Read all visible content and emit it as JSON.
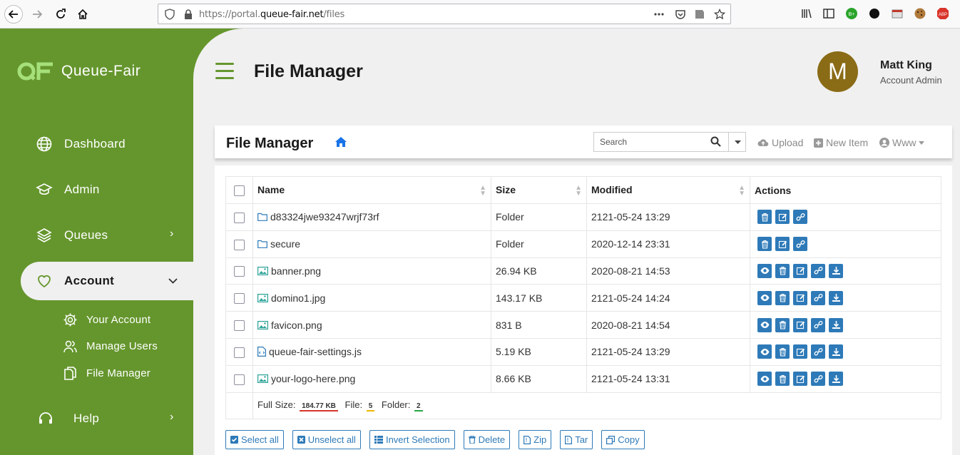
{
  "browser": {
    "url_prefix": "https://portal.",
    "url_domain": "queue-fair.net",
    "url_path": "/files"
  },
  "sidebar": {
    "logo_text": "Queue-Fair",
    "items": [
      {
        "label": "Dashboard",
        "icon": "globe-icon"
      },
      {
        "label": "Admin",
        "icon": "graduation-cap-icon"
      },
      {
        "label": "Queues",
        "icon": "layers-icon",
        "chevron": "›"
      },
      {
        "label": "Account",
        "icon": "heart-icon",
        "chevron": "⌄"
      },
      {
        "label": "Help",
        "icon": "headset-icon",
        "chevron": "›"
      }
    ],
    "sub_items": [
      {
        "label": "Your Account",
        "icon": "gear-icon"
      },
      {
        "label": "Manage Users",
        "icon": "users-icon"
      },
      {
        "label": "File Manager",
        "icon": "files-icon"
      }
    ]
  },
  "header": {
    "title": "File Manager",
    "avatar_letter": "M",
    "user_name": "Matt King",
    "user_role": "Account Admin"
  },
  "card": {
    "title": "File Manager",
    "search_placeholder": "Search",
    "upload_label": "Upload",
    "new_item_label": "New Item",
    "user_menu_label": "Www"
  },
  "table": {
    "headers": {
      "name": "Name",
      "size": "Size",
      "modified": "Modified",
      "actions": "Actions"
    },
    "rows": [
      {
        "name": "d83324jwe93247wrjf73rf",
        "type": "folder",
        "size": "Folder",
        "modified": "2121-05-24 13:29"
      },
      {
        "name": "secure",
        "type": "folder",
        "size": "Folder",
        "modified": "2020-12-14 23:31"
      },
      {
        "name": "banner.png",
        "type": "image",
        "size": "26.94 KB",
        "modified": "2020-08-21 14:53"
      },
      {
        "name": "domino1.jpg",
        "type": "image",
        "size": "143.17 KB",
        "modified": "2121-05-24 14:24"
      },
      {
        "name": "favicon.png",
        "type": "image",
        "size": "831 B",
        "modified": "2020-08-21 14:54"
      },
      {
        "name": "queue-fair-settings.js",
        "type": "code",
        "size": "5.19 KB",
        "modified": "2121-05-24 13:29"
      },
      {
        "name": "your-logo-here.png",
        "type": "image",
        "size": "8.66 KB",
        "modified": "2121-05-24 13:31"
      }
    ],
    "footer": {
      "full_size_label": "Full Size:",
      "full_size_value": "184.77 KB",
      "file_label": "File:",
      "file_count": "5",
      "folder_label": "Folder:",
      "folder_count": "2"
    }
  },
  "bottom_buttons": {
    "select_all": "Select all",
    "unselect_all": "Unselect all",
    "invert": "Invert Selection",
    "delete": "Delete",
    "zip": "Zip",
    "tar": "Tar",
    "copy": "Copy"
  },
  "colors": {
    "brand_green": "#65962d",
    "action_blue": "#2e7ab8",
    "avatar_brown": "#8a6b16"
  }
}
